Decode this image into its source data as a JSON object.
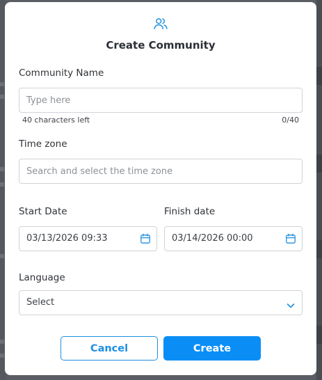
{
  "dialog": {
    "title": "Create Community",
    "icon": "users-icon",
    "accent_color": "#1e8fe1"
  },
  "community_name": {
    "label": "Community Name",
    "placeholder": "Type here",
    "value": "",
    "chars_left_text": "40 characters left",
    "counter_text": "0/40"
  },
  "time_zone": {
    "label": "Time zone",
    "placeholder": "Search and select the time zone"
  },
  "start_date": {
    "label": "Start Date",
    "value": "03/13/2026 09:33"
  },
  "finish_date": {
    "label": "Finish date",
    "value": "03/14/2026 00:00"
  },
  "language": {
    "label": "Language",
    "selected": "Select"
  },
  "actions": {
    "cancel_label": "Cancel",
    "create_label": "Create"
  }
}
